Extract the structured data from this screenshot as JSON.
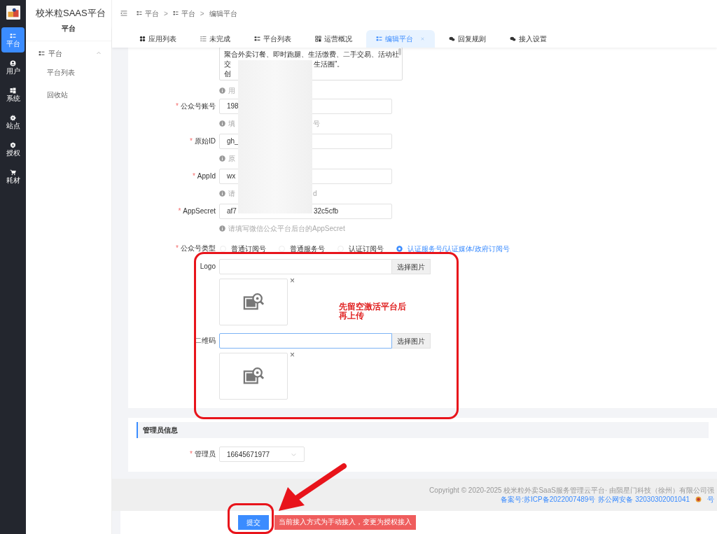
{
  "nav_rail": [
    {
      "label": "平台",
      "selected": true
    },
    {
      "label": "用户",
      "selected": false
    },
    {
      "label": "系统",
      "selected": false
    },
    {
      "label": "站点",
      "selected": false
    },
    {
      "label": "授权",
      "selected": false
    },
    {
      "label": "耗材",
      "selected": false
    }
  ],
  "sidebar": {
    "title": "校米粒SAAS平台",
    "subtitle": "平台",
    "items": [
      {
        "label": "平台",
        "expanded": true,
        "children": [
          {
            "label": "平台列表"
          },
          {
            "label": "回收站"
          }
        ]
      }
    ]
  },
  "breadcrumb": [
    {
      "label": "平台",
      "kind": "link"
    },
    {
      "label": ">",
      "kind": "separator"
    },
    {
      "label": "平台",
      "kind": "link"
    },
    {
      "label": ">",
      "kind": "separator"
    },
    {
      "label": "编辑平台",
      "kind": "current"
    }
  ],
  "tabs": [
    {
      "label": "应用列表",
      "selected": false,
      "closable": false
    },
    {
      "label": "未完成",
      "selected": false,
      "closable": false
    },
    {
      "label": "平台列表",
      "selected": false,
      "closable": false
    },
    {
      "label": "运营概况",
      "selected": false,
      "closable": false
    },
    {
      "label": "编辑平台",
      "selected": true,
      "closable": true
    },
    {
      "label": "回复规则",
      "selected": false,
      "closable": false
    },
    {
      "label": "接入设置",
      "selected": false,
      "closable": false
    }
  ],
  "form": {
    "fields": [
      {
        "kind": "textarea",
        "lines": [
          {
            "start": "聚合外卖订餐、即时跑腿、生活缴费、二手交易、活动社"
          },
          {
            "start": "交",
            "end": "生活圈”。"
          },
          {
            "start": "创"
          }
        ],
        "hint_start": "用"
      },
      {
        "kind": "text",
        "label": "公众号账号",
        "required_mark": "*",
        "value_start": "198",
        "hint_start": "填",
        "hint_end": "号"
      },
      {
        "kind": "text",
        "label": "原始ID",
        "required_mark": "*",
        "value_start": "gh_",
        "hint_start": "原"
      },
      {
        "kind": "text",
        "label": "AppId",
        "required_mark": "*",
        "value_start": "wx",
        "hint_start": "请",
        "hint_end": "d"
      },
      {
        "kind": "text",
        "label": "AppSecret",
        "required_mark": "*",
        "value_start": "af7",
        "value_end": "32c5cfb",
        "hint_start": "请填写微信公众平台后台的AppSecret"
      },
      {
        "kind": "radio",
        "label": "公众号类型",
        "required_mark": "*",
        "options": [
          {
            "label": "普通订阅号",
            "selected": false
          },
          {
            "label": "普通服务号",
            "selected": false
          },
          {
            "label": "认证订阅号",
            "selected": false
          },
          {
            "label": "认证服务号/认证媒体/政府订阅号",
            "selected": true
          }
        ]
      },
      {
        "kind": "image",
        "label": "Logo",
        "button": "选择图片",
        "focused": false,
        "remove": "×"
      },
      {
        "kind": "image",
        "label": "二维码",
        "button": "选择图片",
        "focused": true,
        "remove": "×"
      }
    ],
    "admin_section": {
      "title": "管理员信息",
      "label": "管理员",
      "required_mark": "*",
      "value": "16645671977"
    }
  },
  "footer": {
    "copyright": "Copyright © 2020-2025 校米粒外卖SaaS服务管理云平台· 由陨星门科技（徐州）有限公司强",
    "icp": "备案号:苏ICP备2022007489号",
    "police": "苏公网安备 32030302001041",
    "police_suffix": "号"
  },
  "actions": {
    "submit": "提交",
    "switch": "当前接入方式为手动接入，变更为授权接入"
  },
  "annotation": {
    "note_lines": [
      "先留空激活平台后",
      "再上传"
    ]
  }
}
